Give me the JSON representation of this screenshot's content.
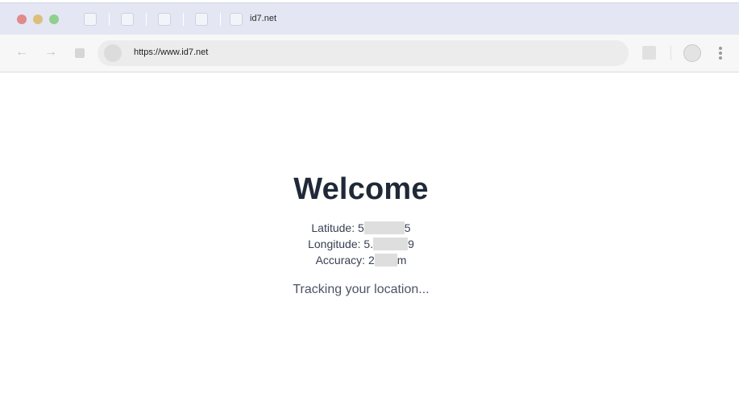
{
  "browser": {
    "tab_title": "id7.net",
    "url": "https://www.id7.net"
  },
  "icons": {
    "back": "back-arrow-icon",
    "forward": "forward-arrow-icon",
    "stop": "stop-icon",
    "site": "site-info-icon",
    "extension": "extension-icon",
    "profile": "profile-icon",
    "menu": "kebab-menu-icon"
  },
  "page": {
    "heading": "Welcome",
    "latitude": {
      "label": "Latitude:",
      "prefix": "5",
      "suffix": "5"
    },
    "longitude": {
      "label": "Longitude:",
      "prefix": "5.",
      "suffix": "9"
    },
    "accuracy": {
      "label": "Accuracy:",
      "prefix": "2",
      "suffix": "m"
    },
    "status": "Tracking your location..."
  },
  "colors": {
    "tabstrip_bg": "#e4e6f3",
    "heading": "#1f2937",
    "redaction": "#dedede"
  }
}
